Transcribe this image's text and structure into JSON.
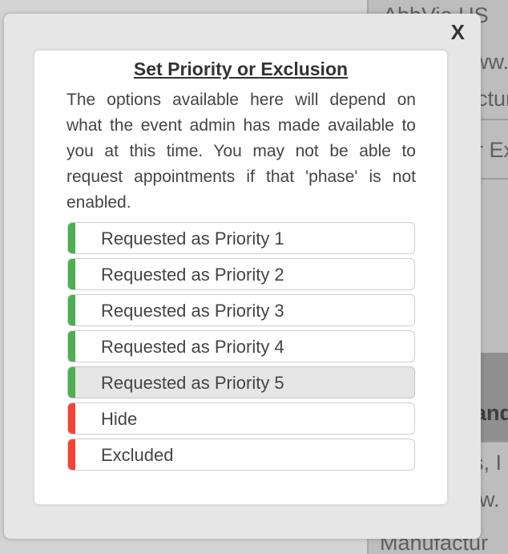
{
  "background": {
    "text_lines": [
      "AbbVie US",
      "ww.",
      "ctur",
      "r Ex",
      "and",
      "s, I",
      "w.",
      "Manufactur"
    ]
  },
  "modal": {
    "close_label": "X",
    "title": "Set Priority or Exclusion",
    "description": "The options available here will depend on what the event admin has made available to you at this time. You may not be able to request appointments if that 'phase' is not enabled.",
    "options": [
      {
        "label": "Requested as Priority 1",
        "status_color": "#4caf50"
      },
      {
        "label": "Requested as Priority 2",
        "status_color": "#4caf50"
      },
      {
        "label": "Requested as Priority 3",
        "status_color": "#4caf50"
      },
      {
        "label": "Requested as Priority 4",
        "status_color": "#4caf50"
      },
      {
        "label": "Requested as Priority 5",
        "status_color": "#4caf50",
        "selected": true
      },
      {
        "label": "Hide",
        "status_color": "#f44336"
      },
      {
        "label": "Excluded",
        "status_color": "#f44336"
      }
    ]
  }
}
